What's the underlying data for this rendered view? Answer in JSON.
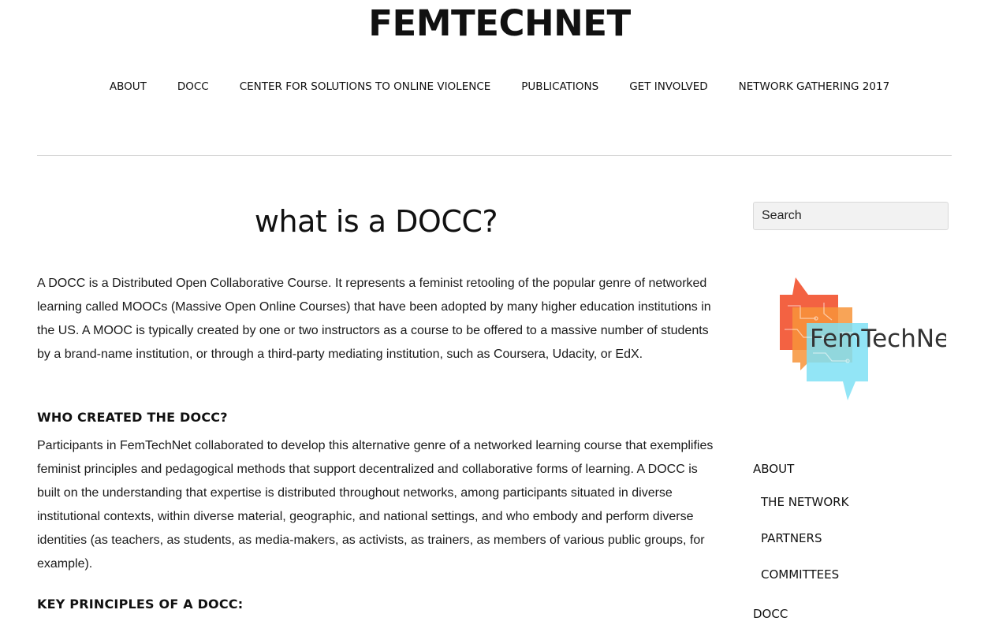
{
  "header": {
    "site_title": "FEMTECHNET",
    "nav": [
      {
        "label": "ABOUT"
      },
      {
        "label": "DOCC"
      },
      {
        "label": "CENTER FOR SOLUTIONS TO ONLINE VIOLENCE"
      },
      {
        "label": "PUBLICATIONS"
      },
      {
        "label": "GET INVOLVED"
      },
      {
        "label": "NETWORK GATHERING 2017"
      }
    ]
  },
  "main": {
    "heading": "what is a DOCC?",
    "intro": "A DOCC is a Distributed Open Collaborative Course.  It represents a feminist retooling of the popular genre of networked learning called MOOCs (Massive Open Online Courses) that have been adopted by many higher education institutions in the US. A MOOC is typically created by one or two instructors as a course to be offered to a massive number of students by a brand-name institution, or through a third-party mediating institution, such as Coursera, Udacity, or EdX.",
    "who_heading": "WHO CREATED THE DOCC?",
    "who_text": "Participants in FemTechNet collaborated to develop this alternative genre of a networked learning course that exemplifies feminist principles and pedagogical methods that support decentralized and collaborative forms of learning. A DOCC is built on the understanding that expertise is distributed throughout networks, among participants situated in diverse institutional contexts, within diverse material, geographic, and national settings, and who embody and perform diverse identities (as teachers, as students, as media-makers, as activists, as trainers, as members of various public groups, for example).",
    "key_heading": "KEY PRINCIPLES OF A DOCC:"
  },
  "sidebar": {
    "search_placeholder": "Search",
    "logo_text": "FemTechNet",
    "nav": {
      "about": "ABOUT",
      "network": "THE NETWORK",
      "partners": "PARTNERS",
      "committees": "COMMITTEES",
      "docc": "DOCC"
    }
  },
  "colors": {
    "logo_red": "#f25a38",
    "logo_orange": "#f7943a",
    "logo_cyan": "#7fe0f5"
  }
}
